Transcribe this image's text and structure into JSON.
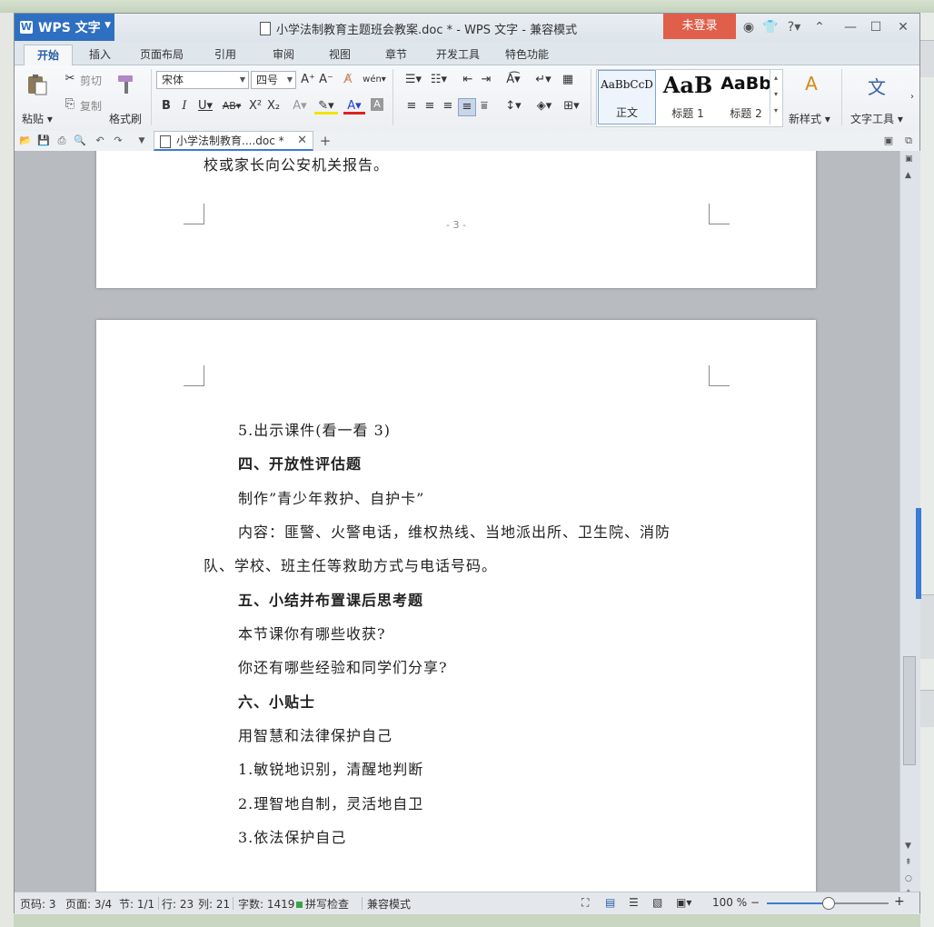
{
  "app": {
    "name": "WPS 文字",
    "window_title": "小学法制教育主题班会教案.doc * - WPS 文字 - 兼容模式",
    "login_label": "未登录"
  },
  "tabs": [
    {
      "label": "开始",
      "active": true
    },
    {
      "label": "插入"
    },
    {
      "label": "页面布局"
    },
    {
      "label": "引用"
    },
    {
      "label": "审阅"
    },
    {
      "label": "视图"
    },
    {
      "label": "章节"
    },
    {
      "label": "开发工具"
    },
    {
      "label": "特色功能"
    }
  ],
  "ribbon": {
    "paste_label": "粘贴",
    "cut_label": "剪切",
    "copy_label": "复制",
    "format_painter_label": "格式刷",
    "font_name": "宋体",
    "font_size": "四号",
    "styles": [
      {
        "sample": "AaBbCcD",
        "name": "正文"
      },
      {
        "sample": "AaB",
        "name": "标题 1"
      },
      {
        "sample": "AaBb",
        "name": "标题 2"
      }
    ],
    "new_style_label": "新样式",
    "text_tools_label": "文字工具"
  },
  "doc_tab": {
    "label": "小学法制教育....doc *"
  },
  "document": {
    "prev_page_tail": "校或家长向公安机关报告。",
    "page_number": "- 3 -",
    "paragraphs": [
      {
        "text": "5.出示课件(看一看 3)",
        "bold": false
      },
      {
        "text": "四、开放性评估题",
        "bold": true
      },
      {
        "text": "制作”青少年救护、自护卡”",
        "bold": false
      },
      {
        "text": "内容：匪警、火警电话，维权热线、当地派出所、卫生院、消防",
        "bold": false
      },
      {
        "text": "队、学校、班主任等救助方式与电话号码。",
        "bold": false
      },
      {
        "text": "五、小结并布置课后思考题",
        "bold": true
      },
      {
        "text": "本节课你有哪些收获?",
        "bold": false
      },
      {
        "text": "你还有哪些经验和同学们分享?",
        "bold": false
      },
      {
        "text": "六、小贴士",
        "bold": true
      },
      {
        "text": "用智慧和法律保护自己",
        "bold": false
      },
      {
        "text": "1.敏锐地识别，清醒地判断",
        "bold": false
      },
      {
        "text": "2.理智地自制，灵活地自卫",
        "bold": false
      },
      {
        "text": "3.依法保护自己",
        "bold": false
      }
    ]
  },
  "status": {
    "page_code": "页码: 3",
    "page": "页面: 3/4",
    "section": "节: 1/1",
    "row": "行: 23",
    "col": "列: 21",
    "word_count": "字数: 1419",
    "spell_check": "拼写检查",
    "compat_mode": "兼容模式",
    "zoom": "100 %",
    "zoom_fraction": 0.5
  },
  "colors": {
    "accent": "#2f6fc2",
    "login_bg": "#e05f4a"
  }
}
